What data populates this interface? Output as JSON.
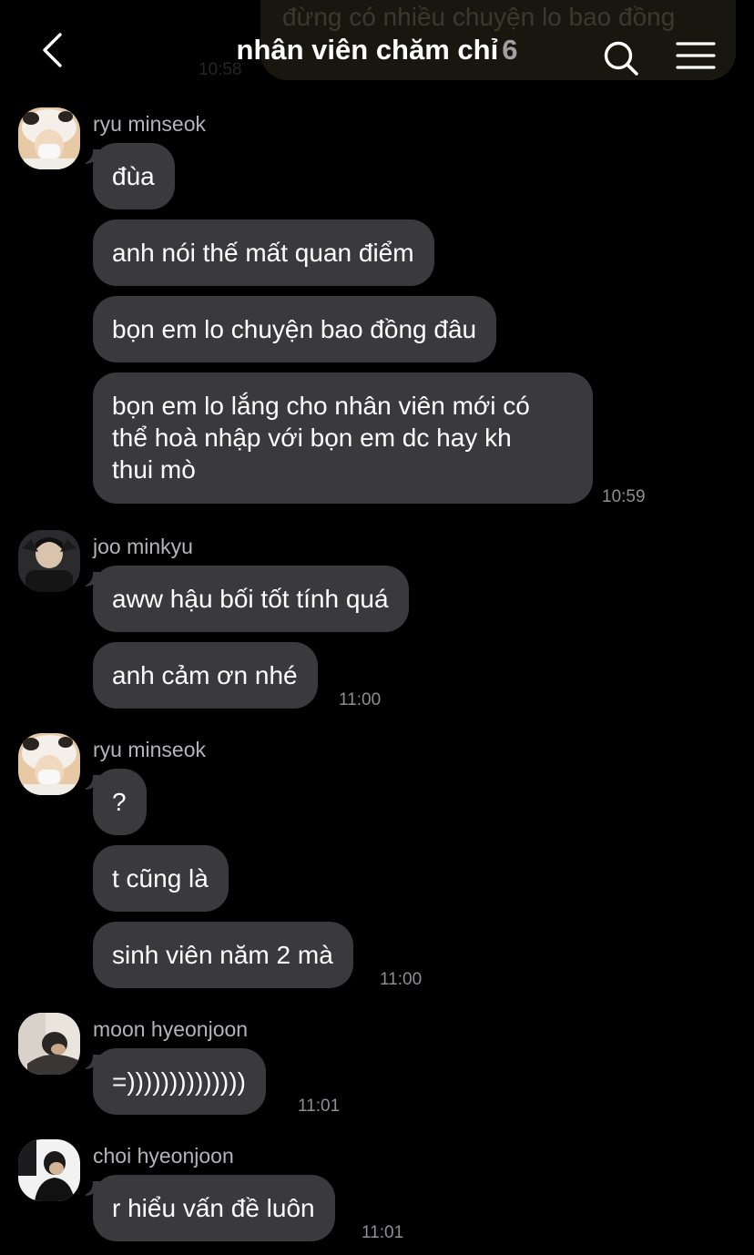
{
  "header": {
    "title": "nhân viên chăm chỉ",
    "member_count": "6",
    "back_icon": "chevron-left-icon",
    "search_icon": "search-icon",
    "menu_icon": "hamburger-menu-icon"
  },
  "top_partial": {
    "text": "đừng có nhiều chuyện lo bao đồng",
    "time": "10:58"
  },
  "colors": {
    "background": "#000000",
    "bubble": "#3a3a3c",
    "sender_name": "#b4b4b8",
    "timestamp": "#8e8e93",
    "member_count": "#a0a0a4"
  },
  "groups": [
    {
      "sender": "ryu minseok",
      "messages": [
        "đùa",
        "anh nói thế mất quan điểm",
        "bọn em lo chuyện bao đồng đâu",
        "bọn em lo lắng cho nhân viên mới có\nthể hoà nhập với bọn em dc hay kh\nthui mò"
      ],
      "time": "10:59"
    },
    {
      "sender": "joo minkyu",
      "messages": [
        "aww hậu bối tốt tính quá",
        "anh cảm ơn nhé"
      ],
      "time": "11:00"
    },
    {
      "sender": "ryu minseok",
      "messages": [
        "?",
        "t cũng là",
        "sinh viên năm 2 mà"
      ],
      "time": "11:00"
    },
    {
      "sender": "moon hyeonjoon",
      "messages": [
        "=))))))))))))))"
      ],
      "time": "11:01"
    },
    {
      "sender": "choi hyeonjoon",
      "messages": [
        "r hiểu vấn đề luôn"
      ],
      "time": "11:01"
    }
  ]
}
